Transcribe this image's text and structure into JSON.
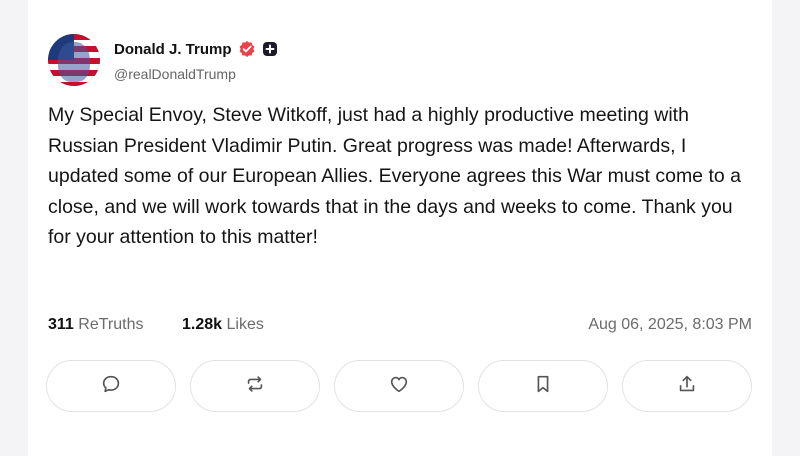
{
  "post": {
    "author": {
      "display_name": "Donald J. Trump",
      "handle": "@realDonaldTrump",
      "verified_color": "#e8424b"
    },
    "text": "My Special Envoy, Steve Witkoff, just had a highly productive meeting with Russian President Vladimir Putin. Great progress was made! Afterwards, I updated some of our European Allies. Everyone agrees this War must come to a close, and we will work towards that in the days and weeks to come. Thank you for your attention to this matter!",
    "stats": {
      "retruths_count": "311",
      "retruths_label": "ReTruths",
      "likes_count": "1.28k",
      "likes_label": "Likes"
    },
    "timestamp": "Aug 06, 2025, 8:03 PM"
  },
  "actions": [
    {
      "icon": "comment-icon"
    },
    {
      "icon": "retruth-icon"
    },
    {
      "icon": "heart-icon"
    },
    {
      "icon": "bookmark-icon"
    },
    {
      "icon": "share-icon"
    }
  ],
  "colors": {
    "text": "#151515",
    "muted": "#6b6b6b",
    "border": "#e2e2e6"
  }
}
